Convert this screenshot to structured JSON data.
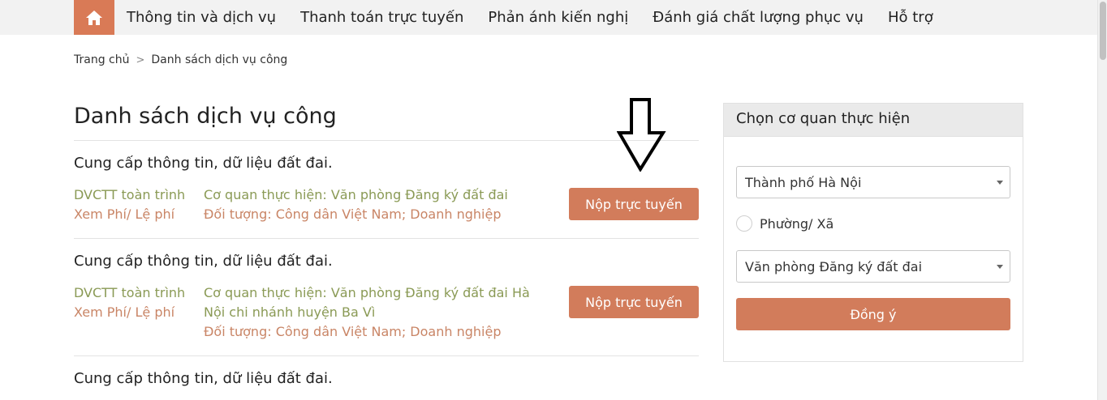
{
  "nav": {
    "home_icon": "home-icon",
    "items": [
      {
        "label": "Thông tin và dịch vụ"
      },
      {
        "label": "Thanh toán trực tuyến"
      },
      {
        "label": "Phản ánh kiến nghị"
      },
      {
        "label": "Đánh giá chất lượng phục vụ"
      },
      {
        "label": "Hỗ trợ"
      }
    ]
  },
  "breadcrumb": {
    "home": "Trang chủ",
    "separator": ">",
    "current": "Danh sách dịch vụ công"
  },
  "main": {
    "title": "Danh sách dịch vụ công",
    "services": [
      {
        "title": "Cung cấp thông tin, dữ liệu đất đai.",
        "level": "DVCTT toàn trình",
        "fee_link": "Xem Phí/ Lệ phí",
        "agency": "Cơ quan thực hiện: Văn phòng Đăng ký đất đai",
        "target": "Đối tượng: Công dân Việt Nam; Doanh nghiệp",
        "button": "Nộp trực tuyến"
      },
      {
        "title": "Cung cấp thông tin, dữ liệu đất đai.",
        "level": "DVCTT toàn trình",
        "fee_link": "Xem Phí/ Lệ phí",
        "agency": "Cơ quan thực hiện: Văn phòng Đăng ký đất đai Hà Nội chi nhánh huyện Ba Vì",
        "target": "Đối tượng: Công dân Việt Nam; Doanh nghiệp",
        "button": "Nộp trực tuyến"
      },
      {
        "title": "Cung cấp thông tin, dữ liệu đất đai."
      }
    ]
  },
  "sidebar": {
    "title": "Chọn cơ quan thực hiện",
    "province_select": "Thành phố Hà Nội",
    "radio_label": "Phường/ Xã",
    "agency_select": "Văn phòng Đăng ký đất đai",
    "submit": "Đồng ý"
  },
  "colors": {
    "accent": "#d27c5b",
    "level_text": "#8a9a55",
    "fee_text": "#c98566"
  },
  "annotation": {
    "icon": "down-arrow-icon"
  }
}
